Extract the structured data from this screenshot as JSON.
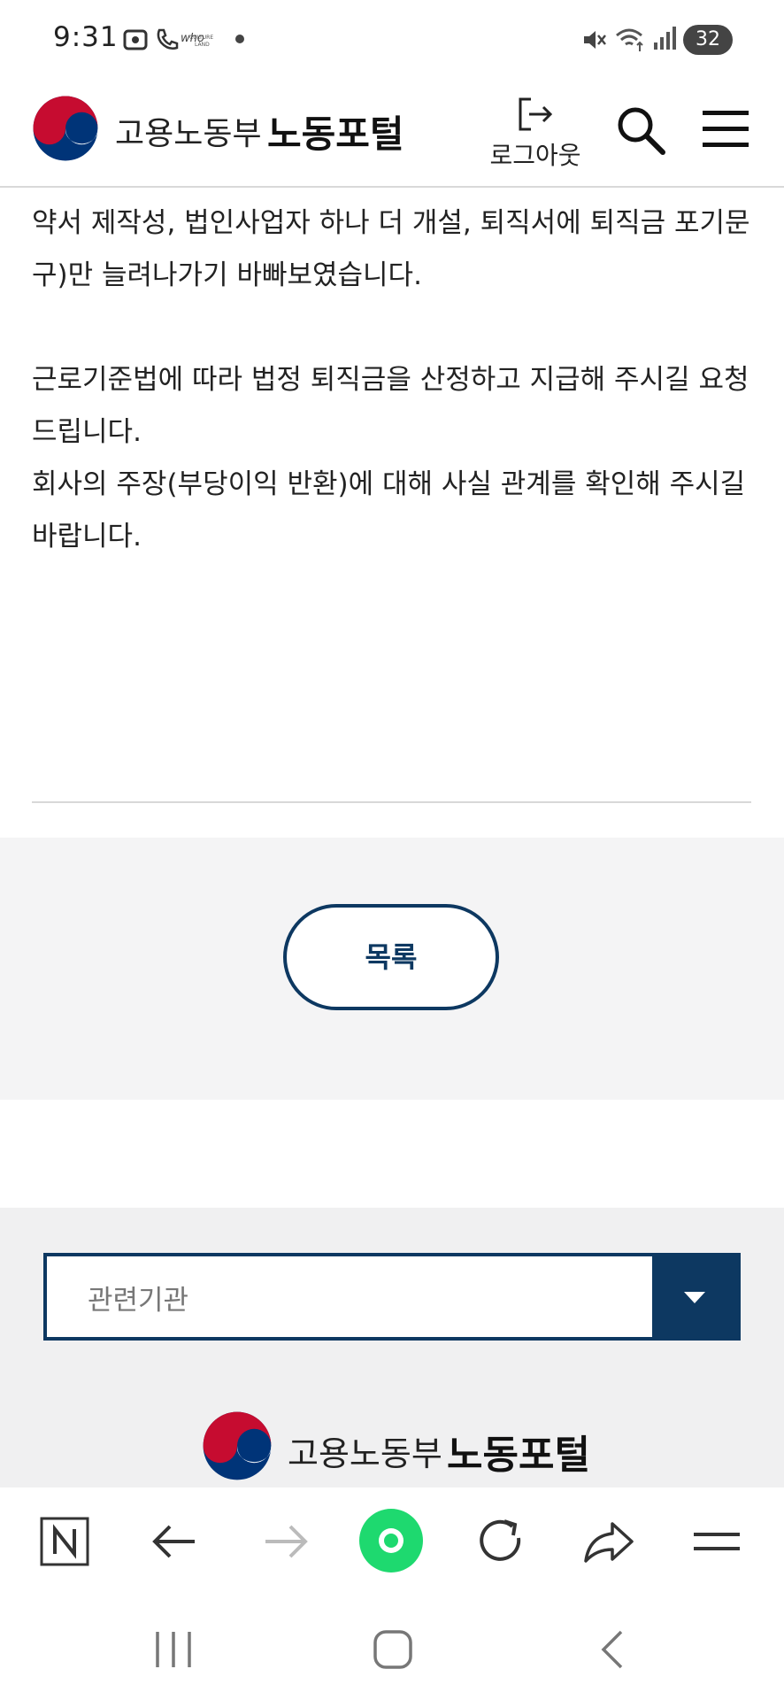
{
  "status_bar": {
    "time": "9:31",
    "battery": "32",
    "icons": [
      "image-icon",
      "call-icon",
      "who-app-icon",
      "culture-land-icon",
      "dot-icon",
      "mute-icon",
      "wifi-icon",
      "signal-icon"
    ]
  },
  "header": {
    "ministry": "고용노동부",
    "portal": "노동포털",
    "logout_label": "로그아웃"
  },
  "content": {
    "paragraphs": [
      "약서 제작성, 법인사업자 하나 더 개설, 퇴직서에 퇴직금 포기문구)만 늘려나가기 바빠보였습니다.",
      "근로기준법에 따라 법정 퇴직금을 산정하고 지급해 주시길 요청드립니다.",
      "회사의 주장(부당이익 반환)에 대해 사실 관계를 확인해 주시길 바랍니다."
    ]
  },
  "list_button_label": "목록",
  "footer": {
    "related_placeholder": "관련기관",
    "ministry": "고용노동부",
    "portal": "노동포털"
  },
  "colors": {
    "accent": "#0d3861",
    "logo_red": "#c60c30",
    "logo_blue": "#003478",
    "browser_home": "#1ed96f"
  }
}
